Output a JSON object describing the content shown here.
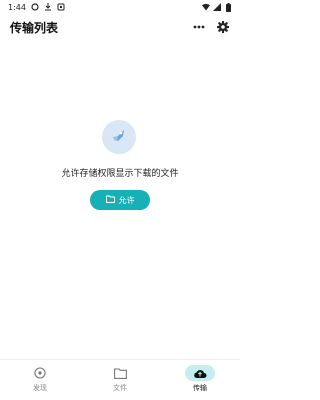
{
  "status_bar": {
    "time": "1:44",
    "left_icons": [
      "sync-icon",
      "download-icon",
      "notification-icon"
    ],
    "right_icons": [
      "wifi-icon",
      "signal-icon",
      "battery-icon"
    ]
  },
  "header": {
    "title": "传输列表",
    "actions": [
      "more-icon",
      "settings-icon"
    ]
  },
  "empty_state": {
    "illustration_icon": "rocket-icon",
    "message": "允许存储权限显示下载的文件",
    "button_label": "允许",
    "button_icon": "folder-icon"
  },
  "bottom_nav": {
    "items": [
      {
        "label": "发现",
        "icon": "discover-icon",
        "active": false
      },
      {
        "label": "文件",
        "icon": "folder-icon",
        "active": false
      },
      {
        "label": "传输",
        "icon": "cloud-transfer-icon",
        "active": true
      }
    ]
  },
  "colors": {
    "accent": "#15b1b6",
    "active_nav_bg": "#c7eeee",
    "illustration_bg": "#d9e6f6"
  }
}
